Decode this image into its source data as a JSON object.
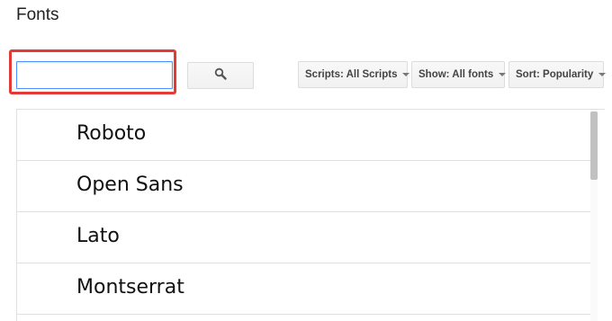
{
  "header": {
    "title": "Fonts"
  },
  "search": {
    "value": "",
    "placeholder": "",
    "button_icon": "search-icon"
  },
  "filters": {
    "scripts_label": "Scripts: All Scripts",
    "show_label": "Show: All fonts",
    "sort_label": "Sort: Popularity"
  },
  "font_list": {
    "items": [
      {
        "label": "Roboto"
      },
      {
        "label": "Open Sans"
      },
      {
        "label": "Lato"
      },
      {
        "label": "Montserrat"
      }
    ]
  },
  "colors": {
    "highlight": "#e53935",
    "input_focus_border": "#4d90fe"
  }
}
